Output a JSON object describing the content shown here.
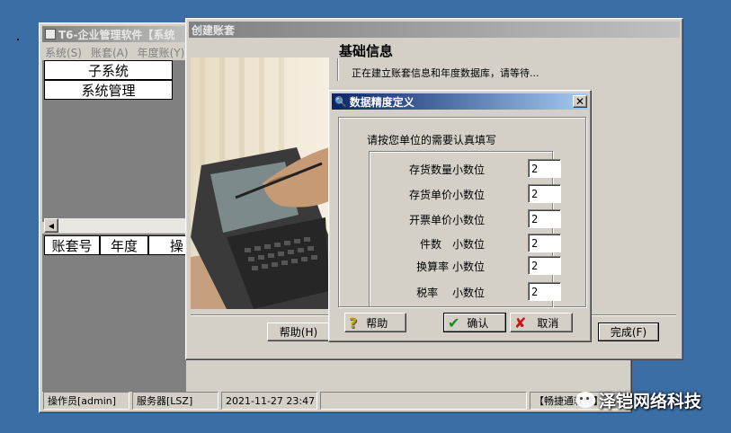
{
  "main_window": {
    "title": "T6-企业管理软件【系统",
    "menu": [
      "系统(S)",
      "账套(A)",
      "年度账(Y)"
    ],
    "grid_top": {
      "header": "子系统",
      "rows": [
        "系统管理"
      ]
    },
    "grid_bottom": {
      "headers": [
        "账套号",
        "年度",
        "操"
      ]
    },
    "status": {
      "operator": "操作员[admin]",
      "server": "服务器[LSZ]",
      "datetime": "2021-11-27 23:47",
      "brand": "【畅捷通软件】"
    }
  },
  "create_dialog": {
    "title": "创建账套",
    "heading": "基础信息",
    "status_text": "正在建立账套信息和年度数据库，请等待...",
    "help_label": "帮助(H)",
    "finish_label": "完成(F)"
  },
  "precision_dialog": {
    "title": "数据精度定义",
    "instruction": "请按您单位的需要认真填写",
    "fields": [
      {
        "label": "存货数量小数位",
        "value": "2"
      },
      {
        "label": "存货单价小数位",
        "value": "2"
      },
      {
        "label": "开票单价小数位",
        "value": "2"
      },
      {
        "label": "件数　小数位",
        "value": "2"
      },
      {
        "label": "换算率 小数位",
        "value": "2"
      },
      {
        "label": "税率　 小数位",
        "value": "2"
      }
    ],
    "buttons": {
      "help": "帮助",
      "ok": "确认",
      "cancel": "取消"
    }
  },
  "watermark": {
    "text": "泽铠网络科技"
  },
  "colors": {
    "desktop": "#3a6ea5",
    "face": "#d4d0c8",
    "active_title": "#0a246a"
  }
}
